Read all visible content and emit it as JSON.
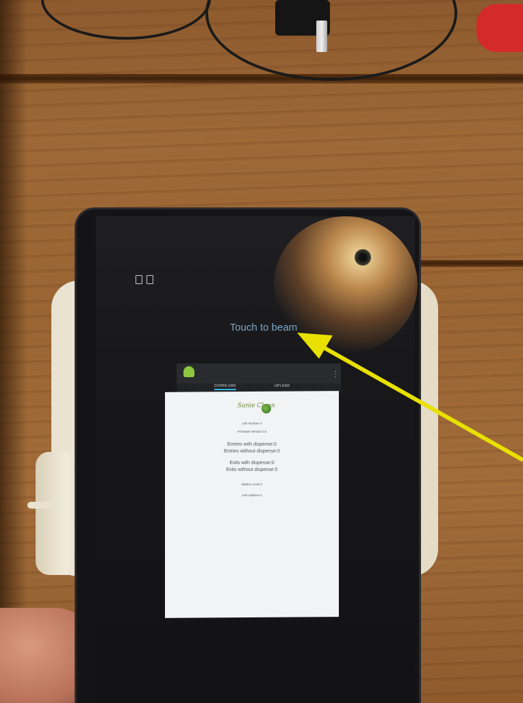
{
  "photo": {
    "beam_prompt": "Touch to beam",
    "app": {
      "tabs": [
        "DOWNLOAD",
        "UPLOAD"
      ],
      "logo_text": "Sanie Clean",
      "unit_number": "Unit Number 0",
      "firmware_version": "Firmware Version 0.0",
      "entries_with": "Entries with dispense:0",
      "entries_without": "Entries without dispense:0",
      "exits_with": "Exits with dispense:0",
      "exits_without": "Exits without dispense:0",
      "battery": "Battery Level 0",
      "unit_address": "Unit Address 0"
    }
  },
  "colors": {
    "arrow": "#e8e000",
    "beam_text": "#7fa7c9",
    "tab_indicator": "#33b5e5"
  }
}
